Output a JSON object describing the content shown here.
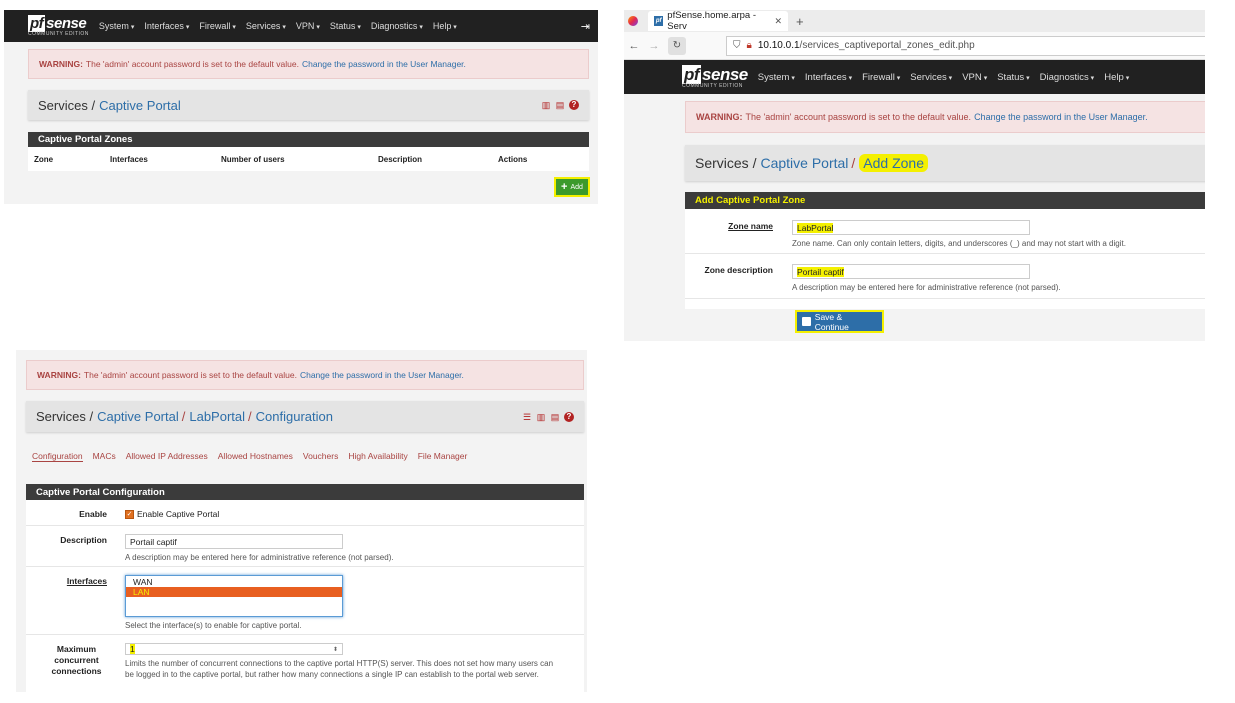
{
  "brand": {
    "name": "sense",
    "pf": "pf",
    "edition": "COMMUNITY EDITION"
  },
  "menu": [
    "System",
    "Interfaces",
    "Firewall",
    "Services",
    "VPN",
    "Status",
    "Diagnostics",
    "Help"
  ],
  "alert": {
    "label": "WARNING:",
    "text": "The 'admin' account password is set to the default value.",
    "link": "Change the password in the User Manager."
  },
  "panel1": {
    "crumb_root": "Services /",
    "crumb_current": "Captive Portal",
    "section_title": "Captive Portal Zones",
    "columns": [
      "Zone",
      "Interfaces",
      "Number of users",
      "Description",
      "Actions"
    ],
    "add_label": "Add"
  },
  "panel2": {
    "tab_title": "pfSense.home.arpa - Serv",
    "url_host": "10.10.0.1",
    "url_path": "/services_captiveportal_zones_edit.php",
    "crumb_root": "Services /",
    "crumb_mid": "Captive Portal",
    "crumb_sep": "/",
    "crumb_current": "Add Zone",
    "section_title": "Add Captive Portal Zone",
    "zone_name_label": "Zone name",
    "zone_name_value": "LabPortal",
    "zone_name_help": "Zone name. Can only contain letters, digits, and underscores (_) and may not start with a digit.",
    "zone_desc_label": "Zone description",
    "zone_desc_value": "Portail captif",
    "zone_desc_help": "A description may be entered here for administrative reference (not parsed).",
    "save_label": "Save & Continue"
  },
  "panel3": {
    "crumb_root": "Services /",
    "crumb_mid": "Captive Portal",
    "crumb_sep1": "/",
    "crumb_zone": "LabPortal",
    "crumb_sep2": "/",
    "crumb_current": "Configuration",
    "tabs": [
      "Configuration",
      "MACs",
      "Allowed IP Addresses",
      "Allowed Hostnames",
      "Vouchers",
      "High Availability",
      "File Manager"
    ],
    "section_title": "Captive Portal Configuration",
    "enable_label": "Enable",
    "enable_text": "Enable Captive Portal",
    "desc_label": "Description",
    "desc_value": "Portail captif",
    "desc_help": "A description may be entered here for administrative reference (not parsed).",
    "ifaces_label": "Interfaces",
    "ifaces_options": [
      "WAN",
      "LAN"
    ],
    "ifaces_help": "Select the interface(s) to enable for captive portal.",
    "maxconn_label_1": "Maximum",
    "maxconn_label_2": "concurrent",
    "maxconn_label_3": "connections",
    "maxconn_value": "1",
    "maxconn_help_1": "Limits the number of concurrent connections to the captive portal HTTP(S) server. This does not set how many users can",
    "maxconn_help_2": "be logged in to the captive portal, but rather how many connections a single IP can establish to the portal web server."
  }
}
